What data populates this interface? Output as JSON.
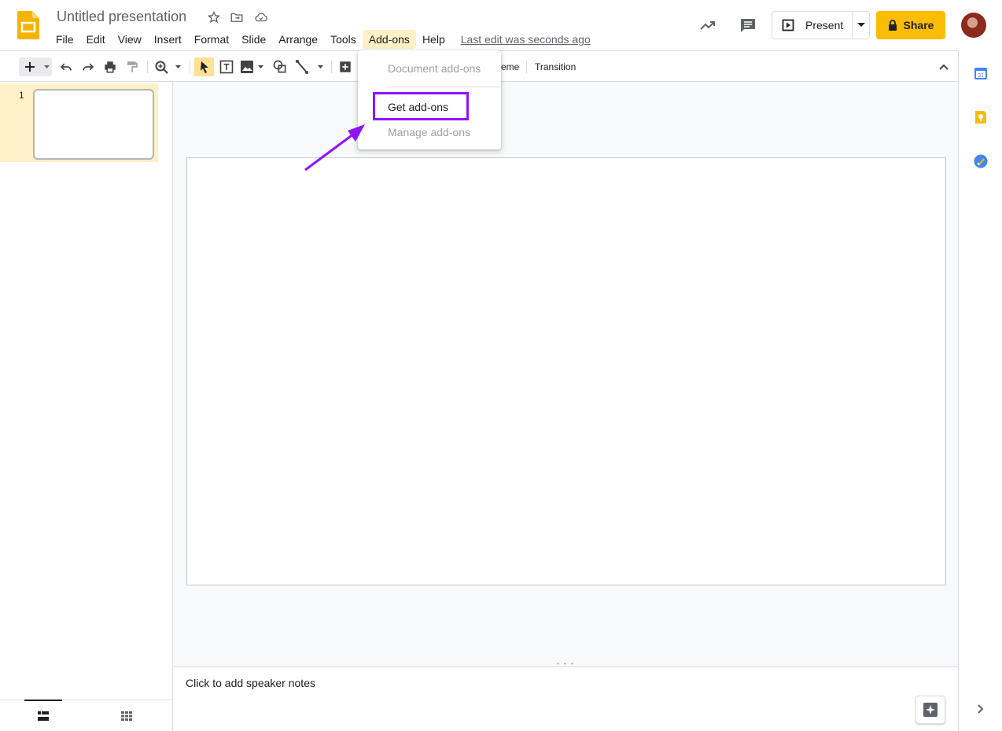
{
  "header": {
    "title": "Untitled presentation",
    "menus": [
      "File",
      "Edit",
      "View",
      "Insert",
      "Format",
      "Slide",
      "Arrange",
      "Tools",
      "Add-ons",
      "Help"
    ],
    "active_menu": "Add-ons",
    "last_edit": "Last edit was seconds ago",
    "present_label": "Present",
    "share_label": "Share"
  },
  "toolbar": {
    "theme_partial": "eme",
    "transition_label": "Transition"
  },
  "addons_menu": {
    "document_addons": "Document add-ons",
    "get_addons": "Get add-ons",
    "manage_addons": "Manage add-ons"
  },
  "filmstrip": {
    "slide_numbers": [
      "1"
    ]
  },
  "notes": {
    "placeholder": "Click to add speaker notes"
  },
  "side_panel": {
    "calendar_day": "31"
  },
  "colors": {
    "accent_yellow": "#fbbc04",
    "annotation_purple": "#9013fe",
    "active_menu_bg": "#fef0c7"
  },
  "icons": [
    "slides-logo-icon",
    "star-icon",
    "move-folder-icon",
    "cloud-saved-icon",
    "activity-trend-icon",
    "comments-icon",
    "present-icon",
    "lock-icon",
    "plus-icon",
    "undo-icon",
    "redo-icon",
    "print-icon",
    "paint-format-icon",
    "zoom-icon",
    "cursor-icon",
    "text-box-icon",
    "image-icon",
    "shape-icon",
    "line-icon",
    "add-comment-icon",
    "chevron-up-icon",
    "calendar-icon",
    "keep-icon",
    "tasks-icon",
    "filmstrip-view-icon",
    "grid-view-icon",
    "explore-icon",
    "chevron-right-icon"
  ]
}
